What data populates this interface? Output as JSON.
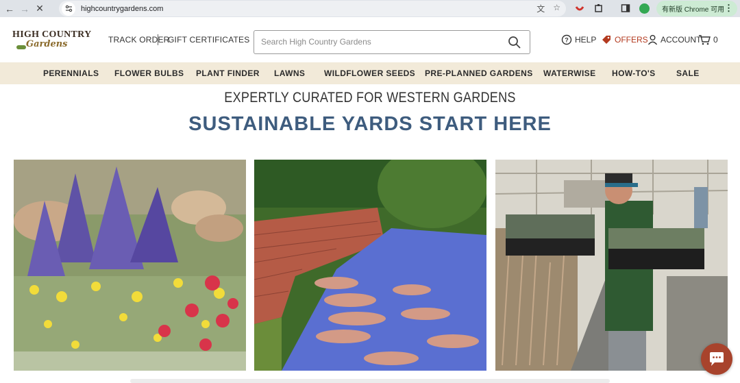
{
  "browser": {
    "url": "highcountrygardens.com",
    "update_label": "有新版 Chrome 可用",
    "icons": [
      "back-icon",
      "forward-icon",
      "stop-icon",
      "site-info-icon",
      "translate-icon",
      "bookmark-star-icon",
      "extension-icon",
      "puzzle-icon",
      "sidebar-icon",
      "profile-icon",
      "menu-dots-icon"
    ]
  },
  "header": {
    "logo_top": "HIGH COUNTRY",
    "logo_bottom": "Gardens",
    "track_order": "TRACK ORDER",
    "gift_certificates": "GIFT CERTIFICATES",
    "search_placeholder": "Search High Country Gardens",
    "help": "HELP",
    "offers": "OFFERS",
    "account": "ACCOUNT",
    "cart_count": "0"
  },
  "nav": {
    "items": [
      "PERENNIALS",
      "FLOWER BULBS",
      "PLANT FINDER",
      "LAWNS",
      "WILDFLOWER SEEDS",
      "PRE-PLANNED GARDENS",
      "WATERWISE",
      "HOW-TO'S",
      "SALE"
    ]
  },
  "hero": {
    "eyebrow": "EXPERTLY CURATED FOR WESTERN GARDENS",
    "headline": "SUSTAINABLE YARDS START HERE"
  },
  "colors": {
    "nav_bg": "#f2ead9",
    "headline": "#3e5c7e",
    "offers": "#b33a1f",
    "chat": "#a8432c"
  }
}
